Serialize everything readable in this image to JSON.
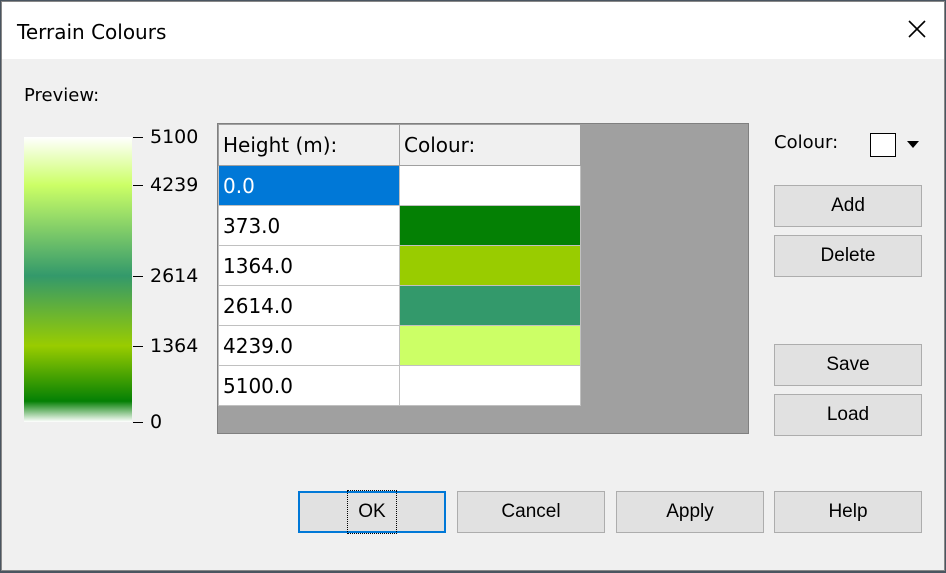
{
  "window": {
    "title": "Terrain Colours"
  },
  "preview": {
    "label": "Preview:",
    "ticks": [
      {
        "label": "5100",
        "value": 5100
      },
      {
        "label": "4239",
        "value": 4239
      },
      {
        "label": "2614",
        "value": 2614
      },
      {
        "label": "1364",
        "value": 1364
      },
      {
        "label": "0",
        "value": 0
      }
    ]
  },
  "table": {
    "headers": [
      "Height (m):",
      "Colour:"
    ],
    "rows": [
      {
        "height": "0.0",
        "colour": "#ffffff",
        "selected": true
      },
      {
        "height": "373.0",
        "colour": "#048004",
        "selected": false
      },
      {
        "height": "1364.0",
        "colour": "#99cc00",
        "selected": false
      },
      {
        "height": "2614.0",
        "colour": "#33996b",
        "selected": false
      },
      {
        "height": "4239.0",
        "colour": "#ccff66",
        "selected": false
      },
      {
        "height": "5100.0",
        "colour": "#ffffff",
        "selected": false
      }
    ]
  },
  "colour_picker": {
    "label": "Colour:",
    "value": "#ffffff"
  },
  "buttons": {
    "add": "Add",
    "delete": "Delete",
    "save": "Save",
    "load": "Load",
    "ok": "OK",
    "cancel": "Cancel",
    "apply": "Apply",
    "help": "Help"
  },
  "accent": "#0078d7"
}
